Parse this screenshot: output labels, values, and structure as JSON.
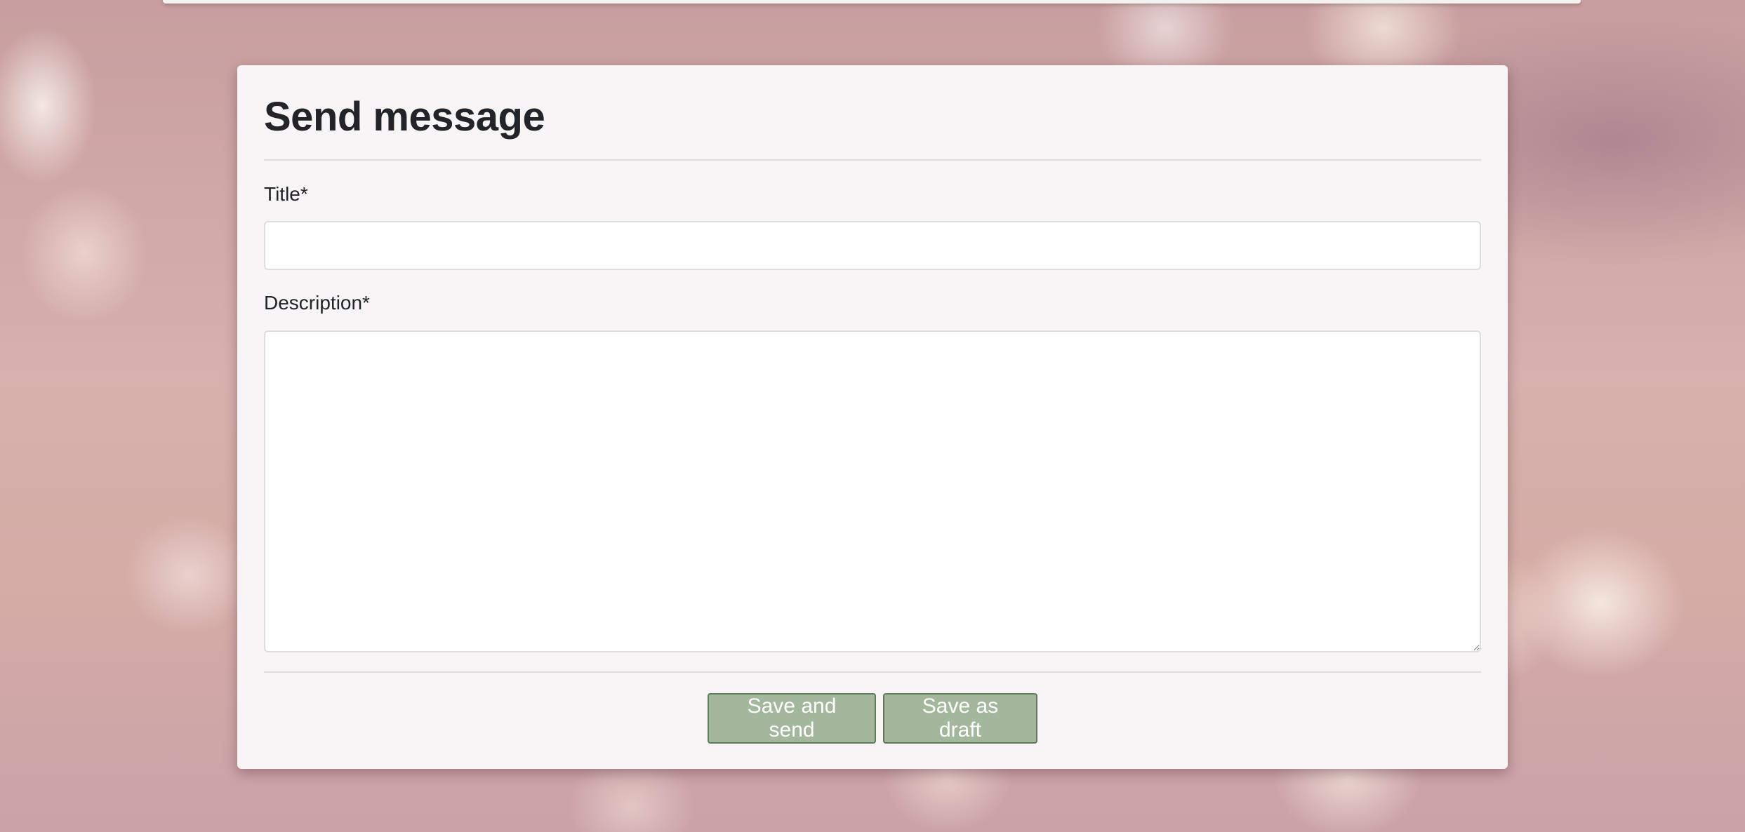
{
  "form": {
    "title": "Send message",
    "fields": {
      "title": {
        "label": "Title*",
        "value": "",
        "placeholder": ""
      },
      "description": {
        "label": "Description*",
        "value": "",
        "placeholder": ""
      }
    },
    "buttons": {
      "save_and_send": "Save and send",
      "save_as_draft": "Save as draft"
    }
  },
  "colors": {
    "button_bg": "#a3b79d",
    "button_border": "#5f7a58",
    "panel_bg": "#f7f5f5"
  }
}
